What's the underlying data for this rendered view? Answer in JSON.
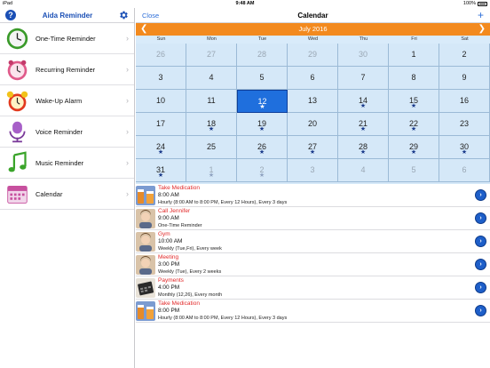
{
  "status": {
    "carrier": "iPad",
    "time": "9:48 AM",
    "battery": "100%"
  },
  "sidebar": {
    "title": "Aida Reminder",
    "items": [
      {
        "label": "One-Time Reminder",
        "icon": "clock-icon"
      },
      {
        "label": "Recurring Reminder",
        "icon": "alarm-clock-icon"
      },
      {
        "label": "Wake-Up Alarm",
        "icon": "alarm-bell-icon"
      },
      {
        "label": "Voice Reminder",
        "icon": "microphone-icon"
      },
      {
        "label": "Music Reminder",
        "icon": "music-note-icon"
      },
      {
        "label": "Calendar",
        "icon": "calendar-icon"
      }
    ]
  },
  "nav": {
    "close_label": "Close",
    "title": "Calendar",
    "add_label": "+"
  },
  "calendar": {
    "month": "July 2016",
    "weekdays": [
      "Sun",
      "Mon",
      "Tue",
      "Wed",
      "Thu",
      "Fri",
      "Sat"
    ],
    "weeks": [
      [
        {
          "d": "26",
          "o": true,
          "s": false
        },
        {
          "d": "27",
          "o": true,
          "s": false
        },
        {
          "d": "28",
          "o": true,
          "s": false
        },
        {
          "d": "29",
          "o": true,
          "s": false
        },
        {
          "d": "30",
          "o": true,
          "s": false
        },
        {
          "d": "1",
          "o": false,
          "s": false
        },
        {
          "d": "2",
          "o": false,
          "s": false
        }
      ],
      [
        {
          "d": "3",
          "o": false,
          "s": false
        },
        {
          "d": "4",
          "o": false,
          "s": false
        },
        {
          "d": "5",
          "o": false,
          "s": false
        },
        {
          "d": "6",
          "o": false,
          "s": false
        },
        {
          "d": "7",
          "o": false,
          "s": false
        },
        {
          "d": "8",
          "o": false,
          "s": false
        },
        {
          "d": "9",
          "o": false,
          "s": false
        }
      ],
      [
        {
          "d": "10",
          "o": false,
          "s": false
        },
        {
          "d": "11",
          "o": false,
          "s": false
        },
        {
          "d": "12",
          "o": false,
          "s": true,
          "sel": true
        },
        {
          "d": "13",
          "o": false,
          "s": false
        },
        {
          "d": "14",
          "o": false,
          "s": true
        },
        {
          "d": "15",
          "o": false,
          "s": true
        },
        {
          "d": "16",
          "o": false,
          "s": false
        }
      ],
      [
        {
          "d": "17",
          "o": false,
          "s": false
        },
        {
          "d": "18",
          "o": false,
          "s": true
        },
        {
          "d": "19",
          "o": false,
          "s": true
        },
        {
          "d": "20",
          "o": false,
          "s": false
        },
        {
          "d": "21",
          "o": false,
          "s": true
        },
        {
          "d": "22",
          "o": false,
          "s": true
        },
        {
          "d": "23",
          "o": false,
          "s": false
        }
      ],
      [
        {
          "d": "24",
          "o": false,
          "s": true
        },
        {
          "d": "25",
          "o": false,
          "s": false
        },
        {
          "d": "26",
          "o": false,
          "s": true
        },
        {
          "d": "27",
          "o": false,
          "s": true
        },
        {
          "d": "28",
          "o": false,
          "s": true
        },
        {
          "d": "29",
          "o": false,
          "s": true
        },
        {
          "d": "30",
          "o": false,
          "s": true
        }
      ],
      [
        {
          "d": "31",
          "o": false,
          "s": true
        },
        {
          "d": "1",
          "o": true,
          "s": true
        },
        {
          "d": "2",
          "o": true,
          "s": true
        },
        {
          "d": "3",
          "o": true,
          "s": false
        },
        {
          "d": "4",
          "o": true,
          "s": false
        },
        {
          "d": "5",
          "o": true,
          "s": false
        },
        {
          "d": "6",
          "o": true,
          "s": false
        }
      ]
    ]
  },
  "events": [
    {
      "title": "Take Medication",
      "time": "8:00 AM",
      "detail": "Hourly (8:00 AM to 8:00 PM, Every 12 Hours), Every 3 days",
      "thumb": "pills"
    },
    {
      "title": "Call Jennifer",
      "time": "9:00 AM",
      "detail": "One-Time Reminder",
      "thumb": "person"
    },
    {
      "title": "Gym",
      "time": "10:00 AM",
      "detail": "Weekly (Tue,Fri), Every week",
      "thumb": "person"
    },
    {
      "title": "Meeting",
      "time": "3:00 PM",
      "detail": "Weekly (Tue), Every 2 weeks",
      "thumb": "person"
    },
    {
      "title": "Payments",
      "time": "4:00 PM",
      "detail": "Monthly (12,26), Every month",
      "thumb": "calculator"
    },
    {
      "title": "Take Medication",
      "time": "8:00 PM",
      "detail": "Hourly (8:00 AM to 8:00 PM, Every 12 Hours), Every 3 days",
      "thumb": "pills"
    }
  ],
  "colors": {
    "accent": "#1a4fb5",
    "month_bar": "#f38a1e",
    "grid": "#d5e8f8",
    "selected": "#1f6fdd",
    "event_title": "#e22a2a"
  }
}
